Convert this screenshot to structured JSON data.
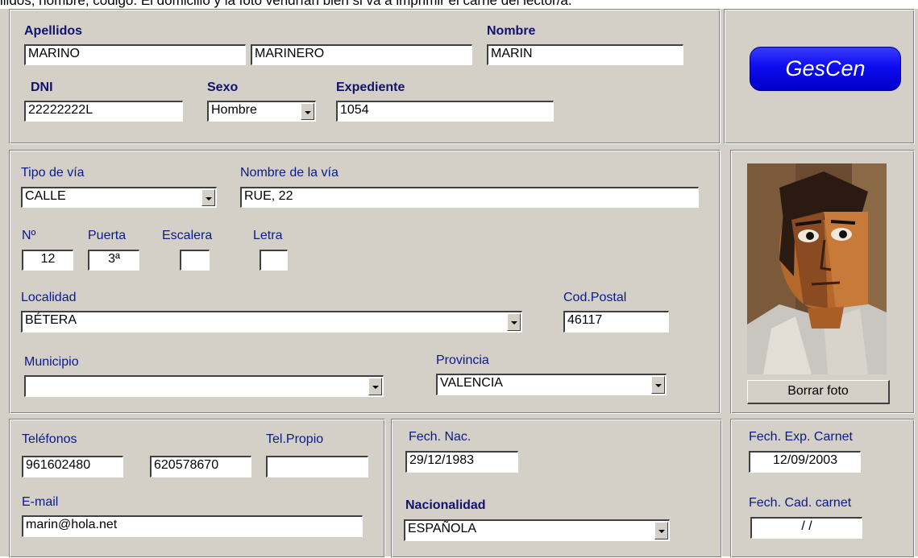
{
  "top_text": "llidos, nombre, código. El domicilio y la foto vendrían bien si va a imprimir el carné del lector/a.",
  "personal": {
    "apellidos_label": "Apellidos",
    "apellido1": "MARINO",
    "apellido2": "MARINERO",
    "nombre_label": "Nombre",
    "nombre": "MARIN",
    "dni_label": "DNI",
    "dni": "22222222L",
    "sexo_label": "Sexo",
    "sexo": "Hombre",
    "expediente_label": "Expediente",
    "expediente": "1054"
  },
  "logo_text": "GesCen",
  "address": {
    "tipo_via_label": "Tipo de vía",
    "tipo_via": "CALLE",
    "nombre_via_label": "Nombre de la vía",
    "nombre_via": "RUE, 22",
    "numero_label": "Nº",
    "numero": "12",
    "puerta_label": "Puerta",
    "puerta": "3ª",
    "escalera_label": "Escalera",
    "escalera": "",
    "letra_label": "Letra",
    "letra": "",
    "localidad_label": "Localidad",
    "localidad": "BÉTERA",
    "cp_label": "Cod.Postal",
    "cp": "46117",
    "municipio_label": "Municipio",
    "municipio": "",
    "provincia_label": "Provincia",
    "provincia": "VALENCIA"
  },
  "photo": {
    "delete_button": "Borrar foto"
  },
  "contact": {
    "telefonos_label": "Teléfonos",
    "telefono1": "961602480",
    "telefono2": "620578670",
    "tel_propio_label": "Tel.Propio",
    "tel_propio": "",
    "email_label": "E-mail",
    "email": "marin@hola.net"
  },
  "birth": {
    "fecha_nac_label": "Fech. Nac.",
    "fecha_nac": "29/12/1983",
    "nacionalidad_label": "Nacionalidad",
    "nacionalidad": "ESPAÑOLA"
  },
  "carnet": {
    "fecha_exp_label": "Fech. Exp. Carnet",
    "fecha_exp": "12/09/2003",
    "fecha_cad_label": "Fech. Cad. carnet",
    "fecha_cad": " / /"
  }
}
